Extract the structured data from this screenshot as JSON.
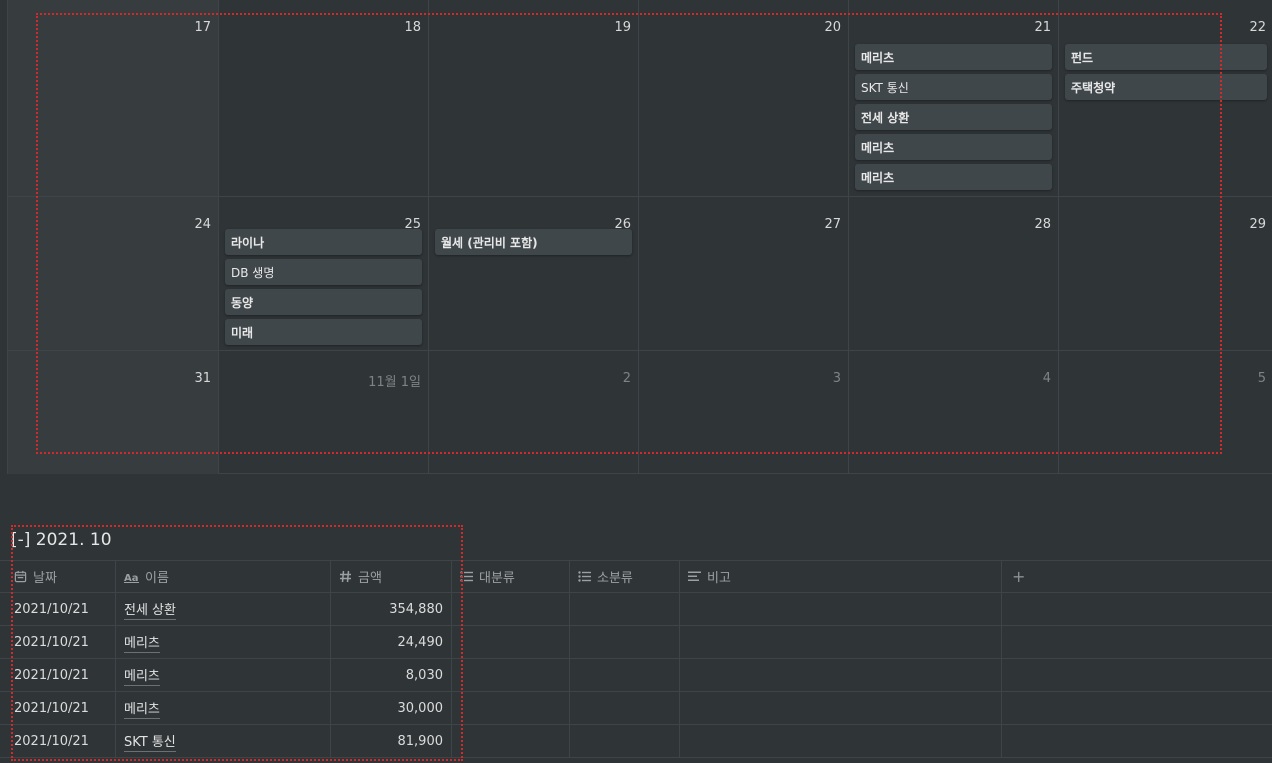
{
  "calendar": {
    "weeks": [
      {
        "days": [
          {
            "num": "17",
            "events": []
          },
          {
            "num": "18",
            "events": []
          },
          {
            "num": "19",
            "events": []
          },
          {
            "num": "20",
            "events": []
          },
          {
            "num": "21",
            "events": [
              "메리츠",
              "SKT 통신",
              "전세 상환",
              "메리츠",
              "메리츠"
            ]
          },
          {
            "num": "22",
            "events": [
              "펀드",
              "주택청약"
            ]
          }
        ]
      },
      {
        "days": [
          {
            "num": "24",
            "events": []
          },
          {
            "num": "25",
            "events": [
              "라이나",
              "DB 생명",
              "동양",
              "미래"
            ]
          },
          {
            "num": "26",
            "events": [
              "월세 (관리비 포함)"
            ]
          },
          {
            "num": "27",
            "events": []
          },
          {
            "num": "28",
            "events": []
          },
          {
            "num": "29",
            "events": []
          }
        ]
      },
      {
        "days": [
          {
            "num": "31",
            "events": []
          },
          {
            "num": "11월 1일",
            "events": []
          },
          {
            "num": "2",
            "events": []
          },
          {
            "num": "3",
            "events": []
          },
          {
            "num": "4",
            "events": []
          },
          {
            "num": "5",
            "events": []
          }
        ]
      }
    ]
  },
  "table": {
    "title": "[-] 2021. 10",
    "headers": {
      "date": "날짜",
      "name": "이름",
      "amount": "금액",
      "category": "대분류",
      "subcategory": "소분류",
      "note": "비고"
    },
    "rows": [
      {
        "date": "2021/10/21",
        "name": "전세 상환",
        "amount": "354,880"
      },
      {
        "date": "2021/10/21",
        "name": "메리츠",
        "amount": "24,490"
      },
      {
        "date": "2021/10/21",
        "name": "메리츠",
        "amount": "8,030"
      },
      {
        "date": "2021/10/21",
        "name": "메리츠",
        "amount": "30,000"
      },
      {
        "date": "2021/10/21",
        "name": "SKT 통신",
        "amount": "81,900"
      }
    ],
    "add_label": "+"
  },
  "colors": {
    "background": "#2f3437",
    "event_card": "#40474b",
    "selection_outline": "#d22a2a"
  }
}
